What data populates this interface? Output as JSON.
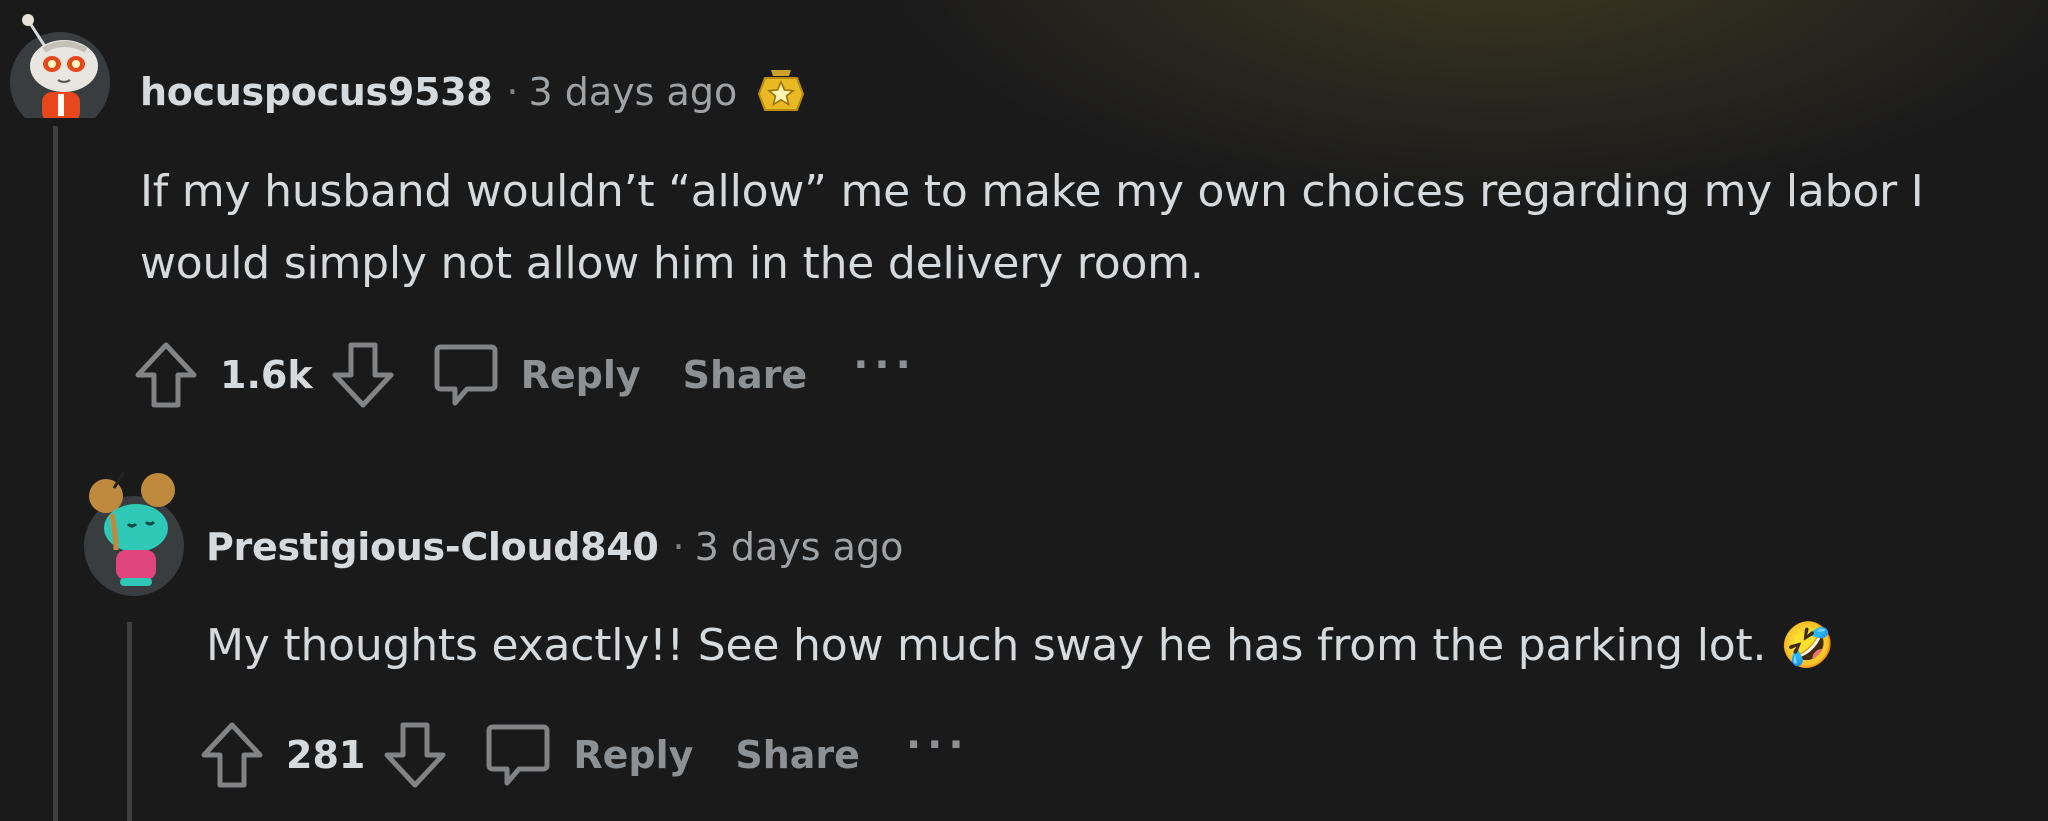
{
  "comments": [
    {
      "username": "hocuspocus9538",
      "separator": "·",
      "time": "3 days ago",
      "badge_icon": "star-award-icon",
      "body": "If my husband wouldn’t “allow” me to make my own choices regarding my labor I would simply not allow him in the delivery room.",
      "score": "1.6k",
      "reply_label": "Reply",
      "share_label": "Share",
      "more_label": "···"
    },
    {
      "username": "Prestigious-Cloud840",
      "separator": "·",
      "time": "3 days ago",
      "body": "My thoughts exactly!! See how much sway he has from the parking lot.",
      "emoji": "🤣",
      "score": "281",
      "reply_label": "Reply",
      "share_label": "Share",
      "more_label": "···"
    }
  ],
  "colors": {
    "background": "#1a1a1b",
    "text": "#d7dadc",
    "muted": "#8e9194",
    "thread_line": "#3f3f42"
  }
}
